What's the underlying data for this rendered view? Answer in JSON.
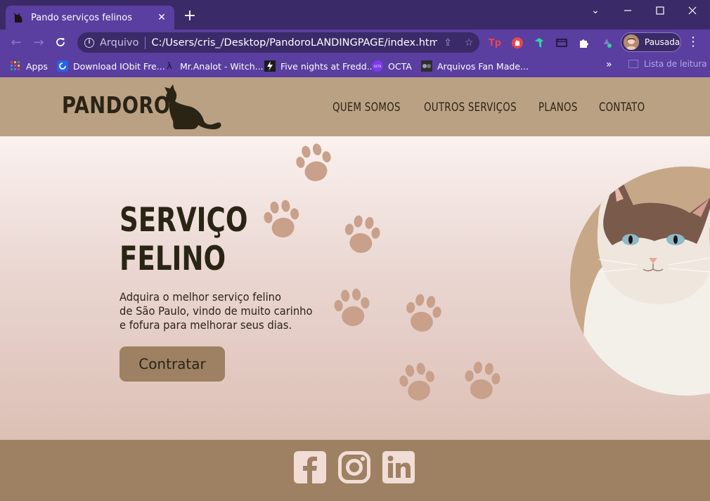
{
  "browser": {
    "tab_title": "Pando serviços felinos",
    "omnibox": {
      "scheme_label": "Arquivo",
      "url": "C:/Users/cris_/Desktop/PandoroLANDINGPAGE/index.html"
    },
    "profile_label": "Pausada",
    "bookmarks": [
      {
        "label": "Apps",
        "icon": "apps-grid-icon"
      },
      {
        "label": "Download IObit Fre...",
        "icon": "iobit-icon"
      },
      {
        "label": "Mr.Analot - Witch...",
        "icon": "lambda-icon"
      },
      {
        "label": "Five nights at Fredd...",
        "icon": "bolt-icon"
      },
      {
        "label": "OCTA",
        "icon": "octa-icon"
      },
      {
        "label": "Arquivos Fan Made...",
        "icon": "fan-icon"
      }
    ],
    "reading_list_label": "Lista de leitura"
  },
  "site": {
    "logo_text": "PANDORO",
    "nav": [
      "QUEM SOMOS",
      "OUTROS SERVIÇOS",
      "PLANOS",
      "CONTATO"
    ],
    "hero": {
      "title_line1": "SERVIÇO",
      "title_line2": "FELINO",
      "description_lines": [
        "Adquira o melhor serviço felino",
        "de São Paulo, vindo de muito carinho",
        "e fofura para melhorar seus dias."
      ],
      "cta_label": "Contratar"
    },
    "social": [
      "facebook-icon",
      "instagram-icon",
      "linkedin-icon"
    ]
  },
  "colors": {
    "chrome": "#3a2a67",
    "toolbar": "#5a3ea0",
    "header": "#bba184",
    "footer": "#9e8163",
    "cta": "#9e8163",
    "paw": "#c9a08a",
    "text_dark": "#2a2415",
    "social_icons": "#f2ddd6"
  }
}
